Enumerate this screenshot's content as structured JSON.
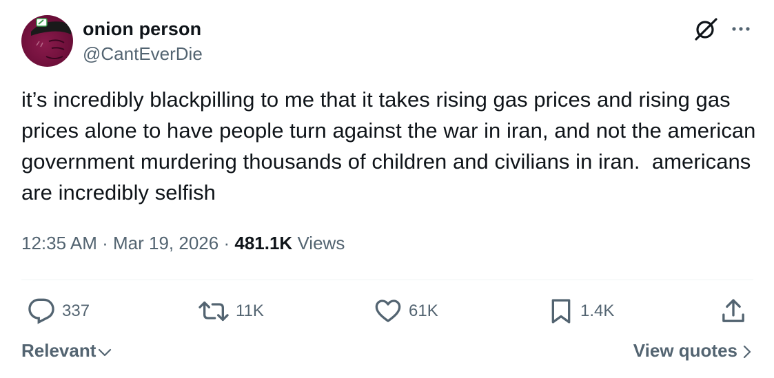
{
  "author": {
    "display_name": "onion person",
    "handle": "@CantEverDie",
    "avatar_icon": "avatar-onion-character"
  },
  "header_icons": {
    "grok": "grok-icon",
    "more": "more-icon"
  },
  "tweet": {
    "text": "it’s incredibly blackpilling to me that it takes rising gas prices and rising gas prices alone to have people turn against the war in iran, and not the american government murdering thousands of children and civilians in iran.  americans are incredibly selfish",
    "time": "12:35 AM",
    "date": "Mar 19, 2026",
    "separator": "·",
    "views_count": "481.1K",
    "views_label": "Views"
  },
  "actions": {
    "replies": "337",
    "reposts": "11K",
    "likes": "61K",
    "bookmarks": "1.4K"
  },
  "footer": {
    "sort_label": "Relevant",
    "view_quotes_label": "View quotes"
  },
  "colors": {
    "text_primary": "#0f1419",
    "text_secondary": "#536471",
    "divider": "#eff3f4",
    "avatar_bg": "#6e0f3a"
  }
}
